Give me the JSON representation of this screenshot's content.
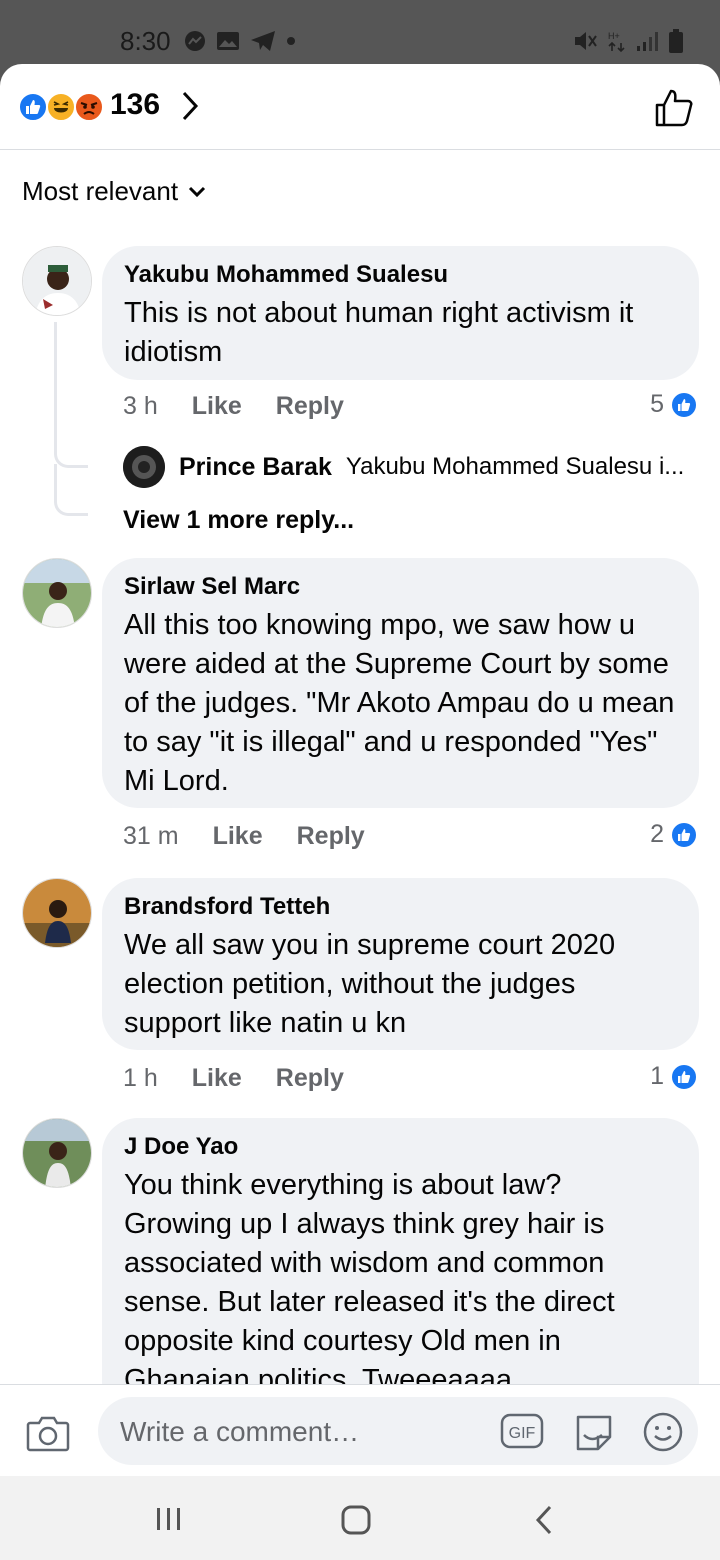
{
  "status": {
    "time": "8:30"
  },
  "header": {
    "reaction_count": "136"
  },
  "sort": {
    "label": "Most relevant"
  },
  "comments": [
    {
      "author": "Yakubu Mohammed Sualesu",
      "text": "This is not about human right activism it idiotism",
      "time": "3 h",
      "like_label": "Like",
      "reply_label": "Reply",
      "likes": "5",
      "reply_preview": {
        "author": "Prince Barak",
        "text": "Yakubu Mohammed Sualesu i..."
      },
      "view_more": "View 1 more reply..."
    },
    {
      "author": "Sirlaw Sel Marc",
      "text": "All this too knowing mpo, we saw how u were aided at the Supreme Court by some of the judges. \"Mr Akoto Ampau do u mean to say \"it is illegal\" and u responded \"Yes\" Mi Lord.",
      "time": "31 m",
      "like_label": "Like",
      "reply_label": "Reply",
      "likes": "2"
    },
    {
      "author": "Brandsford Tetteh",
      "text": "We all saw you in supreme court 2020 election petition, without the judges support like natin u kn",
      "time": "1 h",
      "like_label": "Like",
      "reply_label": "Reply",
      "likes": "1"
    },
    {
      "author": "J Doe Yao",
      "text": "You think everything is about law? Growing up I always think grey hair is associated with wisdom and common sense.  But later released it's the direct opposite kind courtesy Old men in Ghanaian politics. Tweeeaaaa"
    }
  ],
  "composer": {
    "placeholder": "Write a comment…",
    "gif_label": "GIF"
  },
  "colors": {
    "accent": "#1877f2",
    "bubble": "#f0f2f5",
    "meta": "#65676b"
  }
}
